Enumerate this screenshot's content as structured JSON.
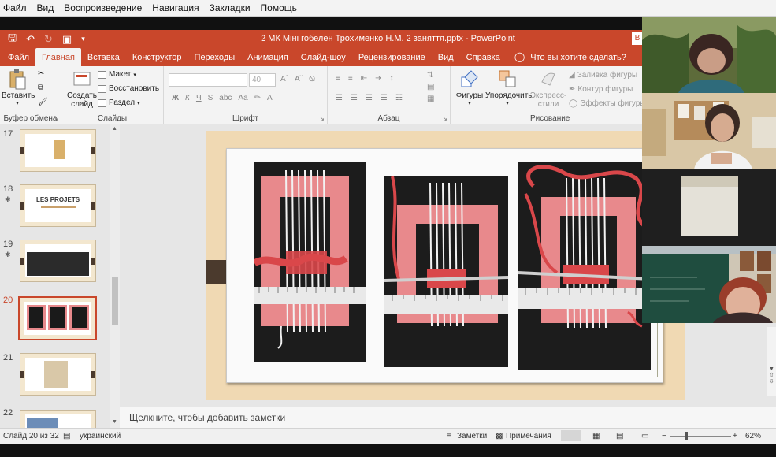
{
  "player_menu": {
    "items": [
      "Файл",
      "Вид",
      "Воспроизведение",
      "Навигация",
      "Закладки",
      "Помощь"
    ]
  },
  "titlebar": {
    "document_title": "2 МК Міні гобелен Трохименко Н.М. 2 заняття.pptx  -  PowerPoint",
    "right_button": "В"
  },
  "tabs": {
    "items": [
      "Файл",
      "Главная",
      "Вставка",
      "Конструктор",
      "Переходы",
      "Анимация",
      "Слайд-шоу",
      "Рецензирование",
      "Вид",
      "Справка"
    ],
    "active": "Главная",
    "tell_me": "Что вы хотите сделать?"
  },
  "ribbon": {
    "clipboard": {
      "paste": "Вставить",
      "label": "Буфер обмена"
    },
    "slides": {
      "new_slide_line1": "Создать",
      "new_slide_line2": "слайд",
      "layout": "Макет",
      "reset": "Восстановить",
      "section": "Раздел",
      "label": "Слайды"
    },
    "font": {
      "size": "40",
      "bold": "Ж",
      "italic": "К",
      "underline": "Ч",
      "strike": "S",
      "spacing": "abc",
      "case": "Aa",
      "label": "Шрифт"
    },
    "paragraph": {
      "label": "Абзац"
    },
    "drawing": {
      "shapes": "Фигуры",
      "arrange": "Упорядочить",
      "quick_styles_line1": "Экспресс-",
      "quick_styles_line2": "стили",
      "fill": "Заливка фигуры",
      "outline": "Контур фигуры",
      "effects": "Эффекты фигуры",
      "label": "Рисование"
    }
  },
  "thumbnails": [
    {
      "number": "17",
      "starred": false,
      "selected": false,
      "caption": ""
    },
    {
      "number": "18",
      "starred": true,
      "selected": false,
      "caption": "LES PROJETS"
    },
    {
      "number": "19",
      "starred": true,
      "selected": false,
      "caption": ""
    },
    {
      "number": "20",
      "starred": false,
      "selected": true,
      "caption": ""
    },
    {
      "number": "21",
      "starred": false,
      "selected": false,
      "caption": ""
    },
    {
      "number": "22",
      "starred": false,
      "selected": false,
      "caption": ""
    }
  ],
  "notes": {
    "placeholder": "Щелкните, чтобы добавить заметки"
  },
  "status": {
    "slide_info": "Слайд 20 из 32",
    "language": "украинский",
    "notes": "Заметки",
    "comments": "Примечания",
    "zoom": "62%"
  },
  "colors": {
    "ppt_accent": "#c9472b",
    "slide_background": "#f0d9b3",
    "slide_tab": "#4b3a2d",
    "weaving_pink": "#e8898c",
    "weaving_yarn": "#d9474a"
  }
}
